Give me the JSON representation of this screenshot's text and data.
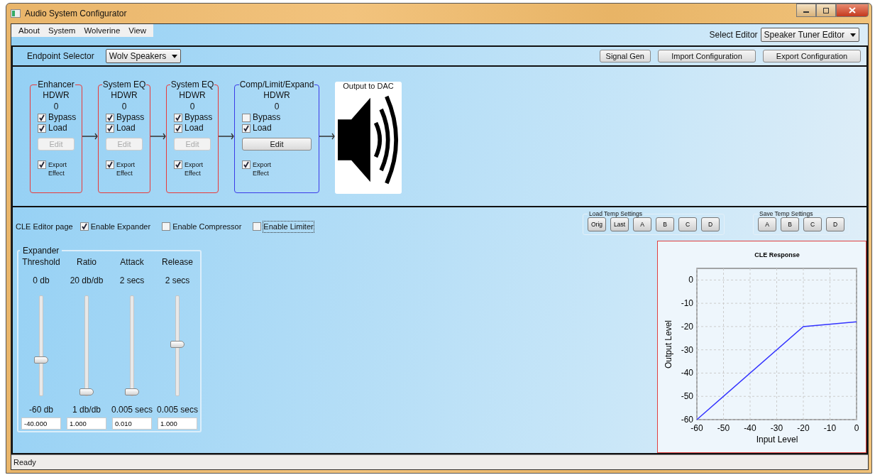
{
  "window": {
    "title": "Audio System Configurator"
  },
  "menu": [
    "About",
    "System",
    "Wolverine",
    "View"
  ],
  "select_editor": {
    "label": "Select Editor",
    "value": "Speaker Tuner Editor"
  },
  "endpoint": {
    "label": "Endpoint Selector",
    "value": "Wolv Speakers"
  },
  "toolbar_buttons": [
    "Signal Gen",
    "Import Configuration",
    "Export Configuration"
  ],
  "effects": [
    {
      "title": "Enhancer",
      "color": "#e83a3a",
      "source": "HDWR",
      "count": "0",
      "checkboxes": [
        {
          "label": "Bypass",
          "checked": true
        },
        {
          "label": "Load",
          "checked": true
        }
      ],
      "edit": {
        "label": "Edit",
        "disabled": true
      },
      "export": {
        "label": "Export Effect",
        "checked": true
      }
    },
    {
      "title": "System EQ",
      "color": "#e83a3a",
      "source": "HDWR",
      "count": "0",
      "checkboxes": [
        {
          "label": "Bypass",
          "checked": true
        },
        {
          "label": "Load",
          "checked": true
        }
      ],
      "edit": {
        "label": "Edit",
        "disabled": true
      },
      "export": {
        "label": "Export Effect",
        "checked": true
      }
    },
    {
      "title": "System EQ",
      "color": "#e83a3a",
      "source": "HDWR",
      "count": "0",
      "checkboxes": [
        {
          "label": "Bypass",
          "checked": true
        },
        {
          "label": "Load",
          "checked": true
        }
      ],
      "edit": {
        "label": "Edit",
        "disabled": true
      },
      "export": {
        "label": "Export Effect",
        "checked": true
      }
    },
    {
      "title": "Comp/Limit/Expand",
      "color": "#3a3ae8",
      "source": "HDWR",
      "count": "0",
      "checkboxes": [
        {
          "label": "Bypass",
          "checked": false
        },
        {
          "label": "Load",
          "checked": true
        }
      ],
      "edit": {
        "label": "Edit",
        "disabled": false
      },
      "export": {
        "label": "Export Effect",
        "checked": true
      }
    }
  ],
  "output": {
    "title": "Output to DAC"
  },
  "cle": {
    "title": "CLE Editor page",
    "options": [
      {
        "label": "Enable Expander",
        "checked": true,
        "focused": false
      },
      {
        "label": "Enable Compressor",
        "checked": false,
        "focused": false
      },
      {
        "label": "Enable Limiter",
        "checked": false,
        "focused": true
      }
    ]
  },
  "load_temp": {
    "title": "Load Temp Settings",
    "buttons": [
      "Orig",
      "Last",
      "A",
      "B",
      "C",
      "D"
    ]
  },
  "save_temp": {
    "title": "Save Temp Settings",
    "buttons": [
      "A",
      "B",
      "C",
      "D"
    ]
  },
  "expander": {
    "title": "Expander",
    "sliders": [
      {
        "name": "Threshold",
        "max": "0 db",
        "min": "-60 db",
        "level": 0.333,
        "value": "-40.000"
      },
      {
        "name": "Ratio",
        "max": "20 db/db",
        "min": "1 db/db",
        "level": 0,
        "value": "1.000"
      },
      {
        "name": "Attack",
        "max": "2 secs",
        "min": "0.005 secs",
        "level": 0.003,
        "value": "0.010"
      },
      {
        "name": "Release",
        "max": "2 secs",
        "min": "0.005 secs",
        "level": 0.5,
        "value": "1.000"
      }
    ]
  },
  "response": {
    "chart_data": {
      "type": "line",
      "title": "CLE Response",
      "xlabel": "Input Level",
      "ylabel": "Output Level",
      "x": [
        -60,
        -20,
        0
      ],
      "series": [
        {
          "color": "#3333ff",
          "values": [
            -60,
            -20,
            -18
          ]
        }
      ],
      "grid": true,
      "xlim": [
        -60,
        0
      ],
      "ylim": [
        -60,
        5
      ],
      "xticks": [
        -60,
        -50,
        -40,
        -30,
        -20,
        -10,
        0
      ],
      "yticks": [
        -60,
        -50,
        -40,
        -30,
        -20,
        -10,
        0
      ]
    }
  },
  "status_bar": "Ready"
}
